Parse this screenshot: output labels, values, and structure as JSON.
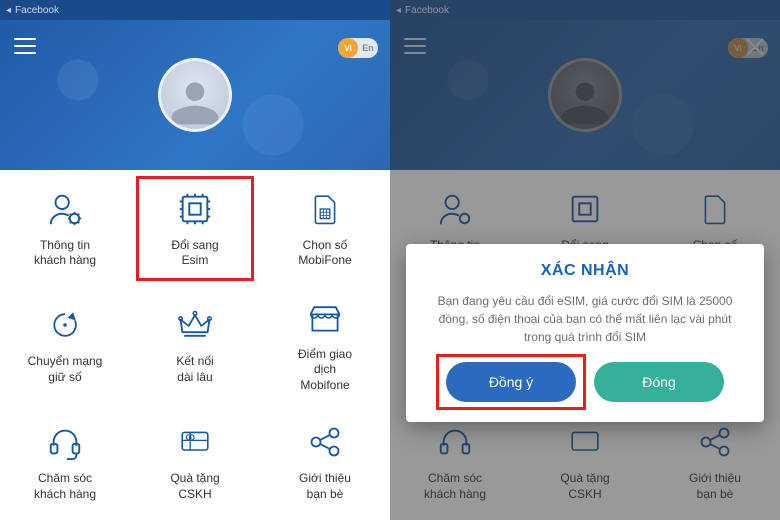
{
  "statusbar": {
    "back_label": "Facebook"
  },
  "header": {
    "lang_vi": "Vi",
    "lang_en": "En"
  },
  "tiles": [
    {
      "id": "customer-info",
      "label": "Thông tin\nkhách hàng"
    },
    {
      "id": "change-esim",
      "label": "Đổi sang\nEsim"
    },
    {
      "id": "pick-number",
      "label": "Chọn số\nMobiFone"
    },
    {
      "id": "switch-keep",
      "label": "Chuyển mạng\ngiữ số"
    },
    {
      "id": "connect-long",
      "label": "Kết nối\ndài lâu"
    },
    {
      "id": "trade-point",
      "label": "Điểm giao\ndịch\nMobifone"
    },
    {
      "id": "customer-care",
      "label": "Chăm sóc\nkhách hàng"
    },
    {
      "id": "gift-cskh",
      "label": "Quà tặng\nCSKH"
    },
    {
      "id": "refer-friend",
      "label": "Giới thiệu\nbạn bè"
    }
  ],
  "dialog": {
    "title": "XÁC NHẬN",
    "body": "Bạn đang yêu cầu đổi eSIM, giá cước đổi SIM là 25000 đồng, số điện thoại của bạn có thể mất liên lạc vài phút trong quá trình đổi SIM",
    "confirm": "Đồng ý",
    "cancel": "Đóng"
  }
}
